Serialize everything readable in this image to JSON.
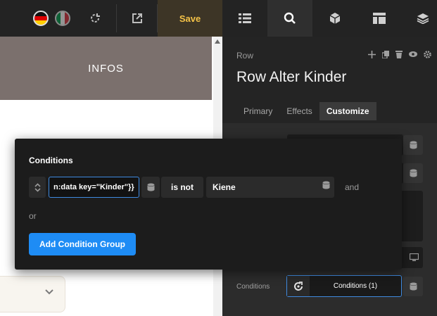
{
  "toolbar": {
    "languages": [
      {
        "icon": "flag-germany-icon"
      },
      {
        "icon": "flag-italy-icon"
      }
    ],
    "undo_icon": "refresh-icon",
    "preview_icon": "external-link-icon",
    "save_label": "Save",
    "tabs": [
      {
        "icon": "list-icon"
      },
      {
        "icon": "search-icon",
        "active": true
      },
      {
        "icon": "cube-icon"
      },
      {
        "icon": "layout-icon"
      },
      {
        "icon": "layers-icon"
      }
    ],
    "colors": {
      "save_text": "#f4c247",
      "accent": "#1e8cf5"
    }
  },
  "canvas": {
    "banner_text": "INFOS"
  },
  "panel": {
    "element_type": "Row",
    "title": "Row Alter Kinder",
    "tabs": [
      {
        "label": "Primary"
      },
      {
        "label": "Effects"
      },
      {
        "label": "Customize",
        "active": true
      }
    ],
    "conditions_label": "Conditions",
    "conditions_button": "Conditions (1)"
  },
  "popup": {
    "title": "Conditions",
    "condition": {
      "key": "n:data key=\"Kinder\"}}",
      "operator": "is not",
      "value": "Kiene",
      "joiner": "and"
    },
    "or_label": "or",
    "add_group_label": "Add Condition Group"
  }
}
